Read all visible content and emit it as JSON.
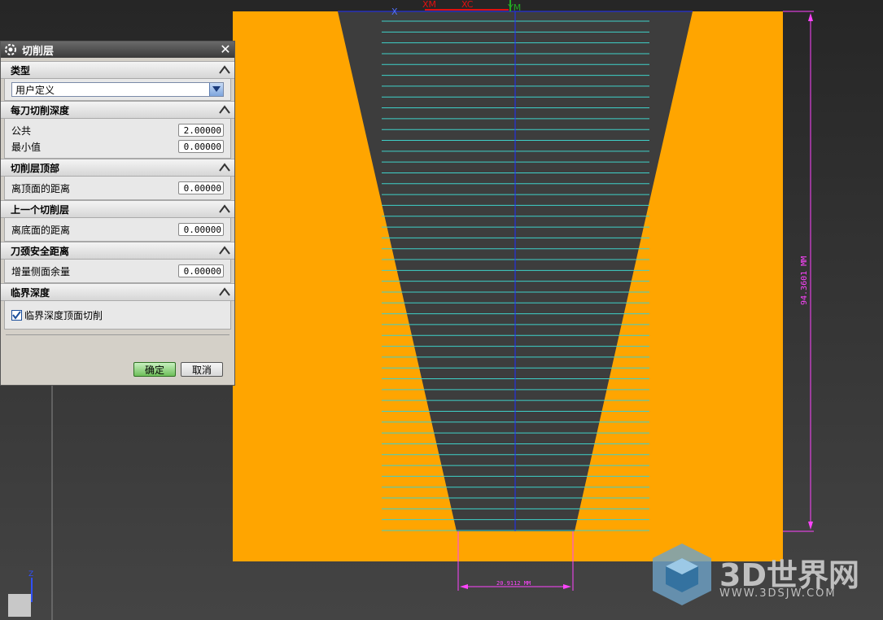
{
  "colors": {
    "part_orange": "#ffa500",
    "cavity_gray": "#3d3d3d",
    "cut_level_cyan": "#3fd1c9",
    "dimension_magenta": "#ff44ff",
    "axis_blue": "#2030ff",
    "annotation_red": "#e01010"
  },
  "viewport": {
    "axis_labels": [
      "X",
      "XM",
      "XC",
      "YM"
    ],
    "dimension_vertical": "94.3601 MM",
    "dimension_horizontal": "20.9112 MM",
    "cut_level_count": 48,
    "corner_axis_label": "Z"
  },
  "dialog": {
    "title": "切削层",
    "sections": {
      "type": {
        "header": "类型",
        "select_value": "用户定义"
      },
      "depth_per_cut": {
        "header": "每刀切削深度",
        "common_label": "公共",
        "common_value": "2.00000",
        "min_label": "最小值",
        "min_value": "0.00000"
      },
      "top_of_levels": {
        "header": "切削层顶部",
        "distance_label": "离顶面的距离",
        "distance_value": "0.00000"
      },
      "last_level": {
        "header": "上一个切削层",
        "distance_label": "离底面的距离",
        "distance_value": "0.00000"
      },
      "tool_neck": {
        "header": "刀颈安全距离",
        "stock_label": "增量侧面余量",
        "stock_value": "0.00000"
      },
      "critical_depth": {
        "header": "临界深度",
        "checkbox_label": "临界深度顶面切削",
        "checked": true
      }
    },
    "ok_label": "确定",
    "cancel_label": "取消"
  },
  "watermark": {
    "brand": "3D世界网",
    "url": "WWW.3DSJW.COM"
  }
}
